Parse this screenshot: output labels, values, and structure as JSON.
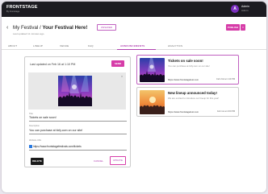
{
  "app": {
    "logo": "FRONTSTAGE",
    "logo_sub": "By Frontstage"
  },
  "user": {
    "initial": "A",
    "name": "Admin",
    "role": "Admin"
  },
  "header": {
    "back_symbol": "‹",
    "crumb_parent": "My Festival /",
    "crumb_current": "Your Festival Here!",
    "status_badge": "UNSAVED",
    "sub_line": "Last updated 11 minutes ago",
    "publish_label": "PUBLISH",
    "more_symbol": "▾"
  },
  "tabs": [
    {
      "label": "ABOUT"
    },
    {
      "label": "LINEUP"
    },
    {
      "label": "VENUE"
    },
    {
      "label": "FAQ"
    },
    {
      "label": "ANNOUNCEMENTS"
    },
    {
      "label": "ANALYTICS"
    }
  ],
  "editor": {
    "last_updated": "Last updated on Feb 16 at 1:10 PM",
    "send_label": "SEND",
    "remove_image_symbol": "×",
    "title_label": "Title",
    "title_value": "Tickets on sale soon!",
    "description_label": "Description",
    "description_value": "You can purchase at tixfy.com on our site!",
    "link_label": "Website URL",
    "link_value": "https://www.frontstagefestivals.com/tickets",
    "delete_label": "DELETE",
    "cancel_label": "CANCEL",
    "update_label": "UPDATE"
  },
  "announcements": [
    {
      "title": "Tickets on sale soon!",
      "description": "You can purchase at tixfy.com on our site!",
      "url": "https://www.frontstagefest.com",
      "date": "Feb 2nd at 1:10 PM"
    },
    {
      "title": "New lineup announced today!",
      "description": "We are excited to introduce our lineup for this year!",
      "url": "https://www.frontstagefest.com",
      "date": "Feb 1st at 4:00 PM"
    }
  ],
  "colors": {
    "accent": "#d63ca8",
    "accent_text": "#b040b0",
    "topbar": "#1c1b21",
    "checkbox": "#2a7ae0"
  }
}
